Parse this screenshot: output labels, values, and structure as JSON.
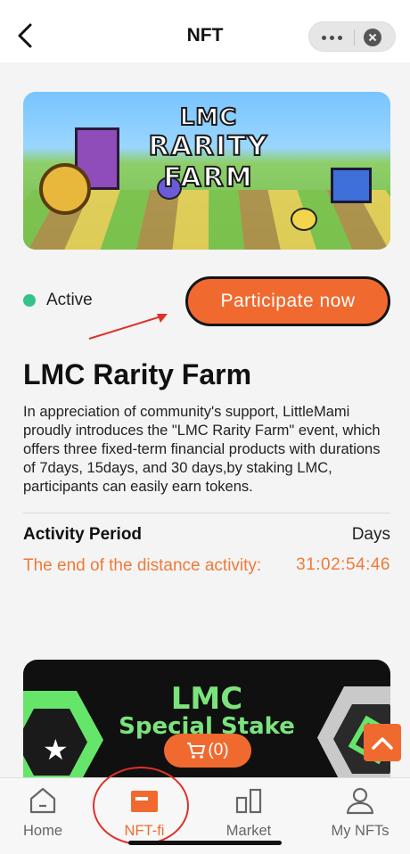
{
  "header": {
    "title": "NFT"
  },
  "banner": {
    "logo_top": "LMC",
    "logo_main": "RARITY FARM"
  },
  "status": {
    "label": "Active",
    "color": "#34c48a"
  },
  "cta": {
    "label": "Participate now",
    "color": "#f06a30"
  },
  "event": {
    "title": "LMC Rarity Farm",
    "description": "In appreciation of community's support, LittleMami proudly introduces the \"LMC Rarity Farm\" event, which offers three fixed-term financial products with durations of 7days, 15days, and 30 days,by staking LMC, participants can easily earn tokens."
  },
  "activity": {
    "period_label": "Activity Period",
    "period_unit": "Days",
    "end_label": "The end of the distance activity:",
    "countdown": "31:02:54:46"
  },
  "next_card": {
    "line1": "LMC",
    "line2": "Special Stake"
  },
  "cart": {
    "count": "(0)"
  },
  "tabs": [
    {
      "label": "Home",
      "icon": "home-icon"
    },
    {
      "label": "NFT-fi",
      "icon": "nft-fi-icon",
      "active": true
    },
    {
      "label": "Market",
      "icon": "market-icon"
    },
    {
      "label": "My NFTs",
      "icon": "user-icon"
    }
  ],
  "colors": {
    "accent": "#f06a30",
    "annotation_red": "#e0302a"
  }
}
